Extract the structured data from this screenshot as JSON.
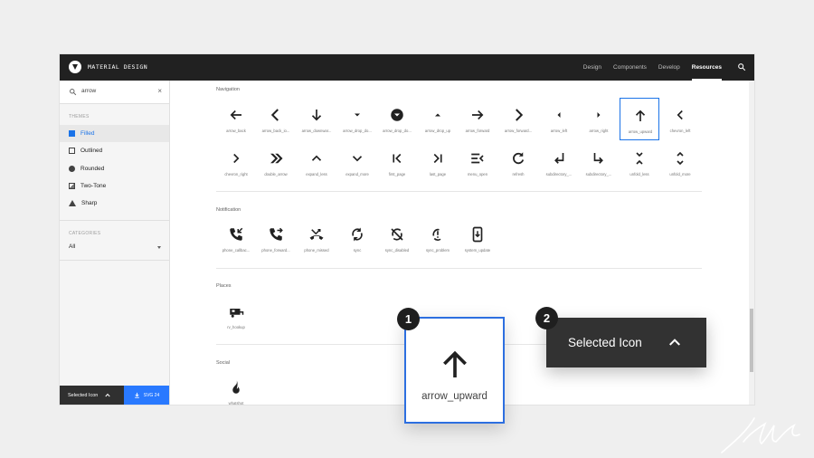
{
  "header": {
    "brand": "MATERIAL DESIGN",
    "nav": [
      "Design",
      "Components",
      "Develop",
      "Resources"
    ],
    "active_nav": "Resources"
  },
  "sidebar": {
    "search_value": "arrow",
    "themes_label": "THEMES",
    "themes": [
      "Filled",
      "Outlined",
      "Rounded",
      "Two-Tone",
      "Sharp"
    ],
    "active_theme": "Filled",
    "categories_label": "CATEGORIES",
    "category_value": "All",
    "selected_icon_label": "Selected Icon",
    "download_label": "SVG 24"
  },
  "sections": [
    {
      "title": "Navigation",
      "icons": [
        "arrow_back",
        "arrow_back_io...",
        "arrow_downwar...",
        "arrow_drop_do...",
        "arrow_drop_do...",
        "arrow_drop_up",
        "arrow_forward",
        "arrow_forward...",
        "arrow_left",
        "arrow_right",
        "arrow_upward",
        "chevron_left",
        "chevron_right",
        "double_arrow",
        "expand_less",
        "expand_more",
        "first_page",
        "last_page",
        "menu_open",
        "refresh",
        "subdirectory_...",
        "subdirectory_...",
        "unfold_less",
        "unfold_more"
      ]
    },
    {
      "title": "Notification",
      "icons": [
        "phone_callbac...",
        "phone_forward...",
        "phone_missed",
        "sync",
        "sync_disabled",
        "sync_problem",
        "system_update"
      ]
    },
    {
      "title": "Places",
      "icons": [
        "rv_hookup"
      ]
    },
    {
      "title": "Social",
      "icons": [
        "whatshot"
      ]
    }
  ],
  "selected_icon": "arrow_upward",
  "callout": {
    "badge_1": "1",
    "badge_2": "2",
    "zoom_icon_name": "arrow_upward",
    "zoom_panel_label": "Selected Icon"
  },
  "colors": {
    "header_bg": "#212121",
    "accent": "#1a73e8",
    "download_bg": "#2979ff",
    "panel_bg": "#323232"
  }
}
